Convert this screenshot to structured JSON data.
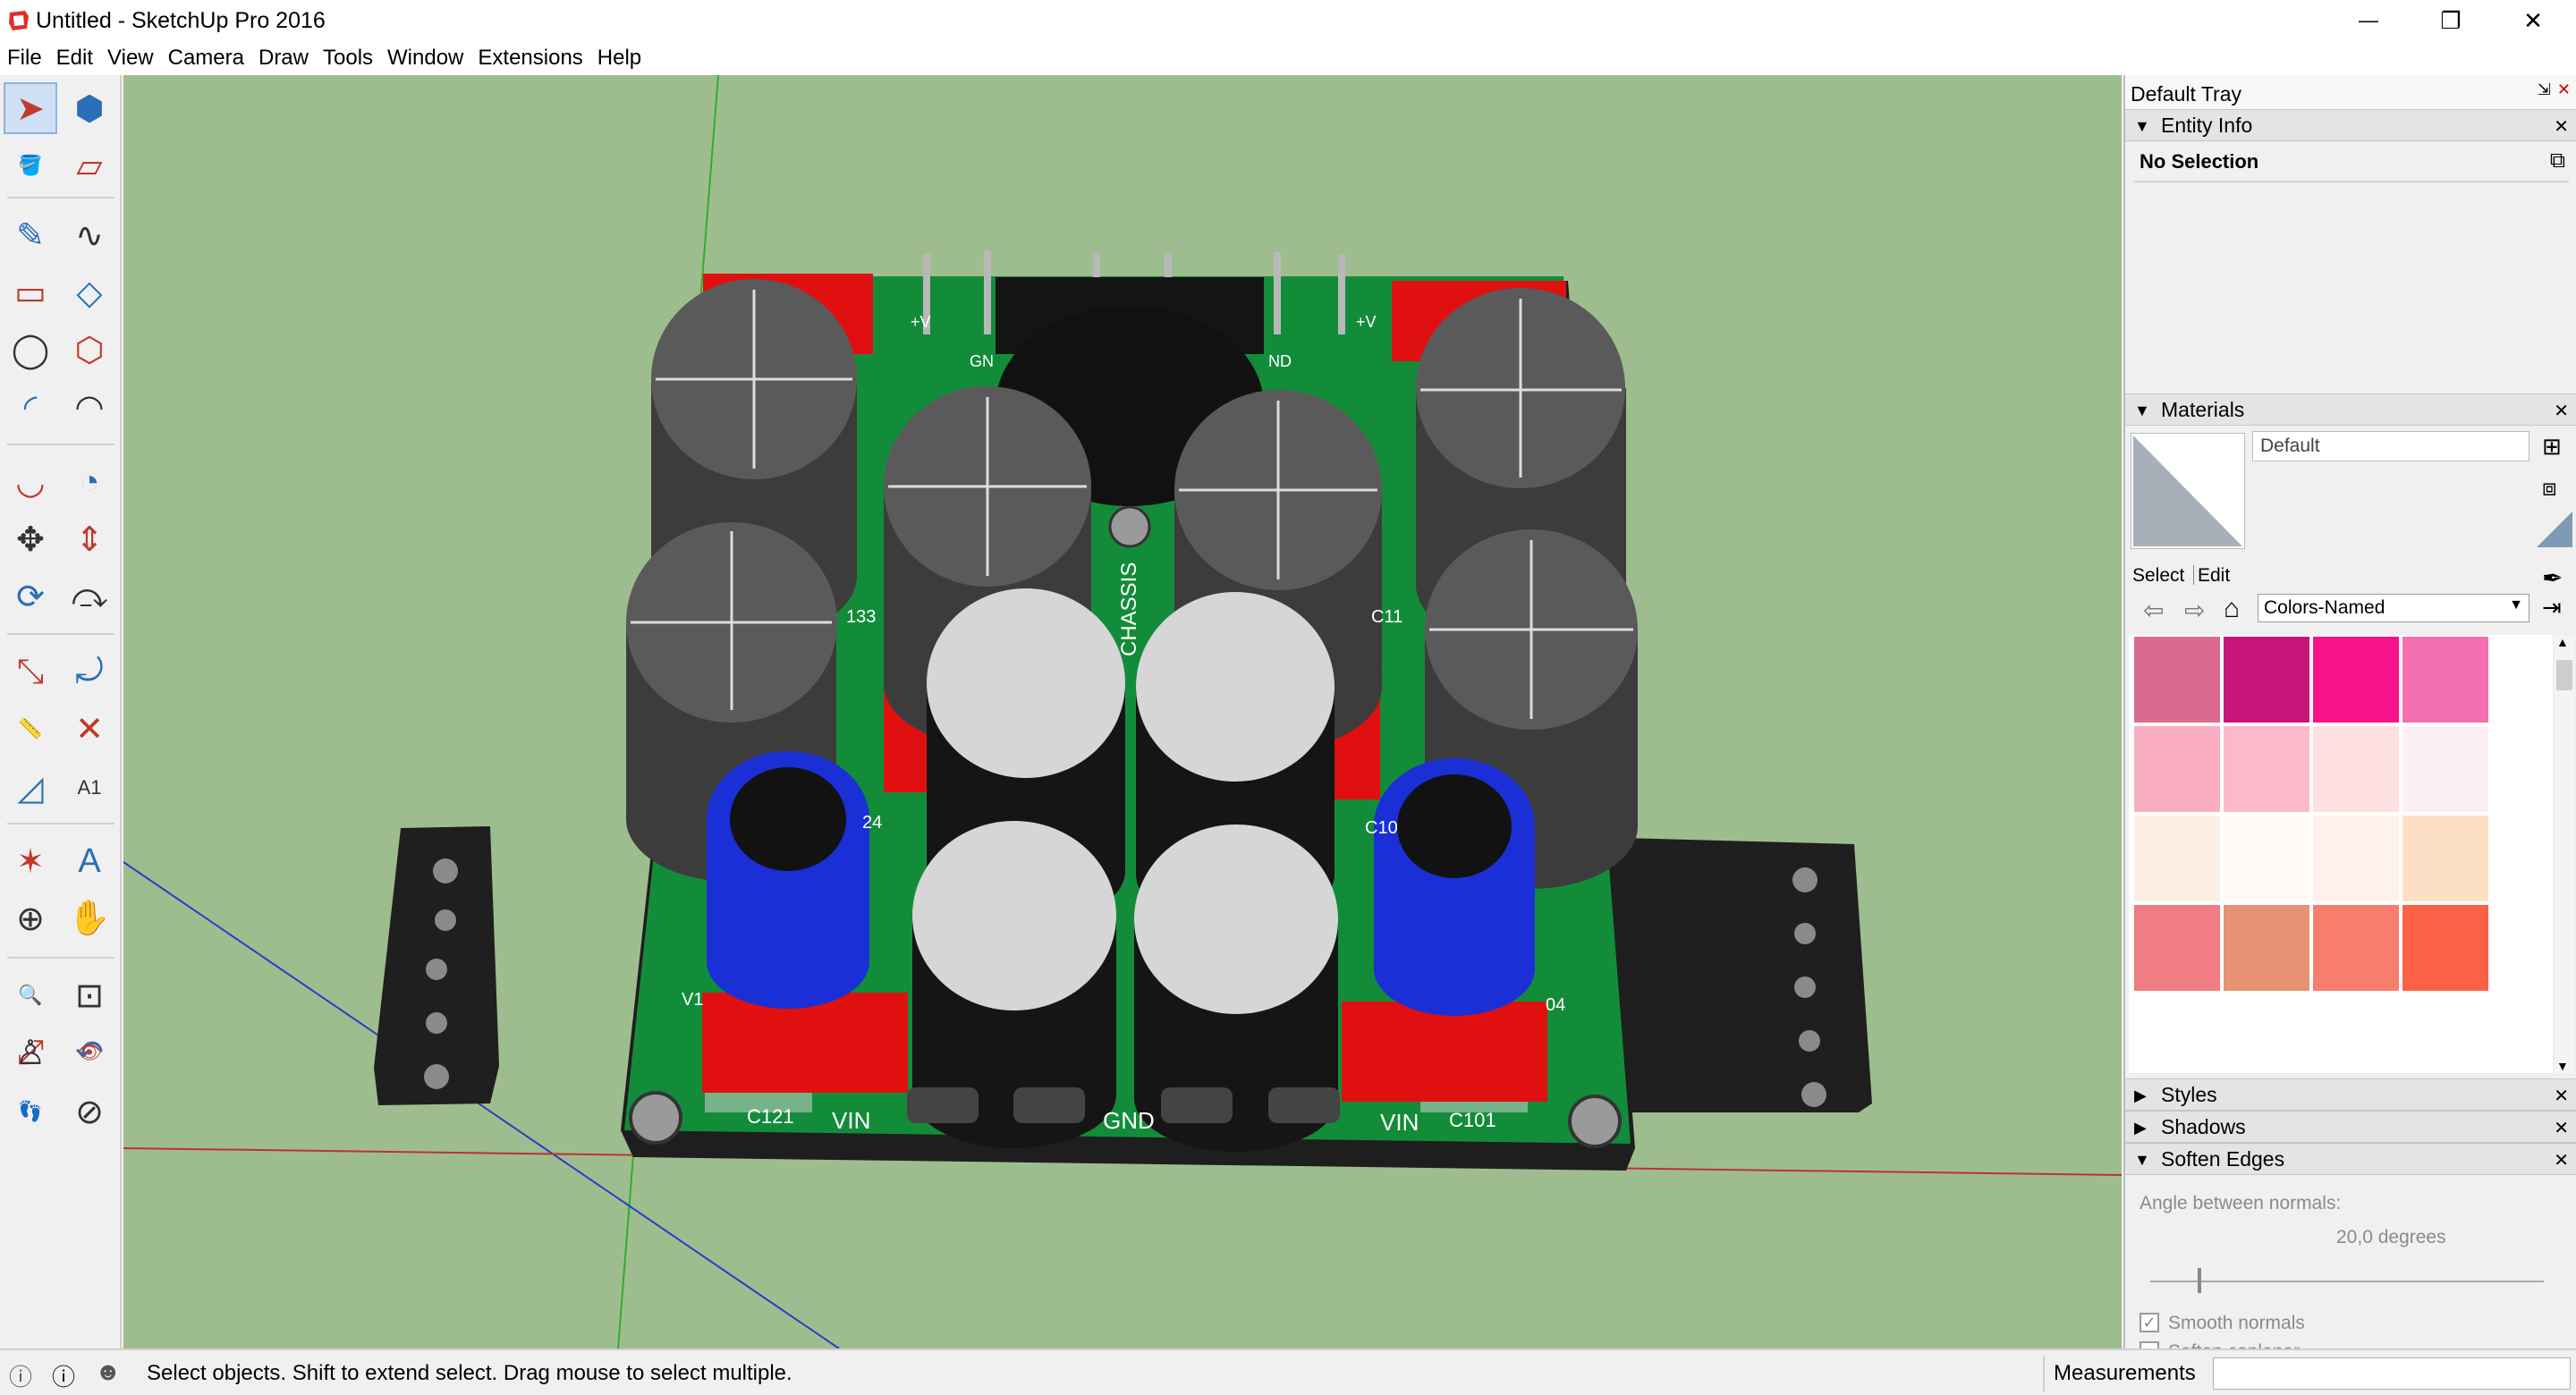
{
  "window": {
    "title": "Untitled - SketchUp Pro 2016",
    "minimize_glyph": "—",
    "maximize_glyph": "❐",
    "close_glyph": "✕"
  },
  "menu": [
    "File",
    "Edit",
    "View",
    "Camera",
    "Draw",
    "Tools",
    "Window",
    "Extensions",
    "Help"
  ],
  "toolbar": {
    "tools": [
      {
        "name": "select-tool-icon",
        "glyph": "➤"
      },
      {
        "name": "make-component-icon",
        "glyph": "⬢"
      },
      {
        "name": "paint-bucket-icon",
        "glyph": "🪣"
      },
      {
        "name": "eraser-icon",
        "glyph": "▱"
      },
      {
        "name": "pencil-line-icon",
        "glyph": "✎"
      },
      {
        "name": "freehand-icon",
        "glyph": "∿"
      },
      {
        "name": "rectangle-icon",
        "glyph": "▭"
      },
      {
        "name": "rotated-rectangle-icon",
        "glyph": "◇"
      },
      {
        "name": "circle-icon",
        "glyph": "◯"
      },
      {
        "name": "polygon-icon",
        "glyph": "⬡"
      },
      {
        "name": "arc-icon",
        "glyph": "◜"
      },
      {
        "name": "two-point-arc-icon",
        "glyph": "◠"
      },
      {
        "name": "three-point-arc-icon",
        "glyph": "◡"
      },
      {
        "name": "pie-icon",
        "glyph": "◔"
      },
      {
        "name": "move-icon",
        "glyph": "✥"
      },
      {
        "name": "push-pull-icon",
        "glyph": "⇕"
      },
      {
        "name": "rotate-icon",
        "glyph": "⟳"
      },
      {
        "name": "follow-me-icon",
        "glyph": "⤼"
      },
      {
        "name": "scale-icon",
        "glyph": "⤡"
      },
      {
        "name": "offset-icon",
        "glyph": "⤾"
      },
      {
        "name": "tape-measure-icon",
        "glyph": "📏"
      },
      {
        "name": "dimension-icon",
        "glyph": "✕"
      },
      {
        "name": "protractor-icon",
        "glyph": "◿"
      },
      {
        "name": "text-tool-icon",
        "glyph": "A1"
      },
      {
        "name": "axes-icon",
        "glyph": "✶"
      },
      {
        "name": "3d-text-icon",
        "glyph": "A"
      },
      {
        "name": "orbit-icon",
        "glyph": "⊕"
      },
      {
        "name": "pan-icon",
        "glyph": "✋"
      },
      {
        "name": "zoom-icon",
        "glyph": "🔍"
      },
      {
        "name": "zoom-window-icon",
        "glyph": "⊡"
      },
      {
        "name": "zoom-extents-icon",
        "glyph": "⤢"
      },
      {
        "name": "previous-view-icon",
        "glyph": "↶"
      },
      {
        "name": "position-camera-icon",
        "glyph": "♙"
      },
      {
        "name": "look-around-icon",
        "glyph": "👁"
      },
      {
        "name": "walk-icon",
        "glyph": "👣"
      },
      {
        "name": "section-plane-icon",
        "glyph": "⊘"
      }
    ]
  },
  "model": {
    "silk_labels": [
      "CHASSIS",
      "GND",
      "VIN",
      "VIN",
      "C121",
      "C101",
      "+V",
      "+V",
      "GN",
      "ND",
      "C10",
      "24",
      "V1",
      "04",
      "133",
      "C11"
    ]
  },
  "tray": {
    "title": "Default Tray",
    "entity_info": {
      "header": "Entity Info",
      "selection": "No Selection"
    },
    "materials": {
      "header": "Materials",
      "current": "Default",
      "tab_select": "Select",
      "tab_edit": "Edit",
      "collection": "Colors-Named",
      "swatches": [
        "#d96a91",
        "#c8157a",
        "#f7118a",
        "#f46fb0",
        "#f9aec1",
        "#fbb9cb",
        "#fde0df",
        "#fdf0f4",
        "#fbeee2",
        "#fffaf5",
        "#fff2ec",
        "#fde0c4",
        "#ef7d83",
        "#e59372",
        "#f77d6d",
        "#fa6147"
      ]
    },
    "styles": {
      "header": "Styles"
    },
    "shadows": {
      "header": "Shadows"
    },
    "soften_edges": {
      "header": "Soften Edges",
      "angle_label": "Angle between normals:",
      "angle_value": "20,0  degrees",
      "angle_fraction": 0.12,
      "smooth_normals": "Smooth normals",
      "soften_coplanar": "Soften coplanar",
      "smooth_checked": true,
      "coplanar_checked": false
    }
  },
  "status": {
    "text": "Select objects. Shift to extend select. Drag mouse to select multiple.",
    "measurements_label": "Measurements",
    "measurements_value": ""
  }
}
